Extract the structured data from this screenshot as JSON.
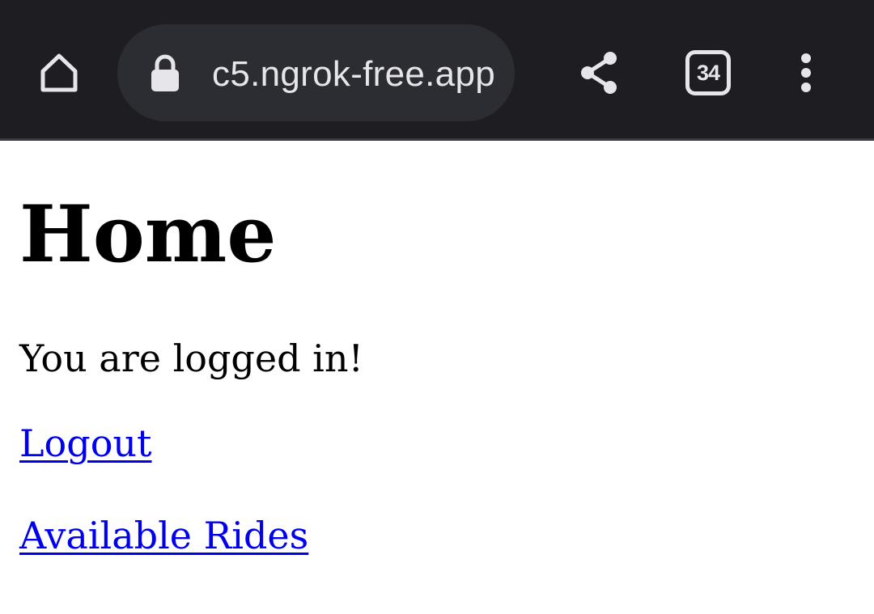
{
  "browser": {
    "url": "c5.ngrok-free.app",
    "tab_count": "34",
    "icons": {
      "home": "home-icon",
      "lock": "lock-icon",
      "share": "share-icon",
      "tabs": "tabs-icon",
      "menu": "more-vert-icon"
    },
    "colors": {
      "toolbar_bg": "#1e1e22",
      "url_pill_bg": "#2c2d33",
      "icon_color": "#e6e6ea"
    }
  },
  "page": {
    "title": "Home",
    "status": "You are logged in!",
    "links": {
      "logout": "Logout",
      "available_rides": "Available Rides"
    },
    "colors": {
      "link": "#0000ee",
      "text": "#000000",
      "background": "#ffffff"
    }
  }
}
